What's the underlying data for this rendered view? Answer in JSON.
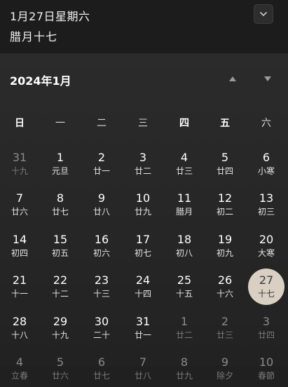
{
  "header": {
    "date": "1月27日星期六",
    "lunar_date": "腊月十七"
  },
  "calendar": {
    "month_title": "2024年1月",
    "weekdays": [
      "日",
      "一",
      "二",
      "三",
      "四",
      "五",
      "六"
    ],
    "weeks": [
      [
        {
          "day": "31",
          "lunar": "十九",
          "dim": true
        },
        {
          "day": "1",
          "lunar": "元旦"
        },
        {
          "day": "2",
          "lunar": "廿一"
        },
        {
          "day": "3",
          "lunar": "廿二"
        },
        {
          "day": "4",
          "lunar": "廿三"
        },
        {
          "day": "5",
          "lunar": "廿四"
        },
        {
          "day": "6",
          "lunar": "小寒"
        }
      ],
      [
        {
          "day": "7",
          "lunar": "廿六"
        },
        {
          "day": "8",
          "lunar": "廿七"
        },
        {
          "day": "9",
          "lunar": "廿八"
        },
        {
          "day": "10",
          "lunar": "廿九"
        },
        {
          "day": "11",
          "lunar": "腊月"
        },
        {
          "day": "12",
          "lunar": "初二"
        },
        {
          "day": "13",
          "lunar": "初三"
        }
      ],
      [
        {
          "day": "14",
          "lunar": "初四"
        },
        {
          "day": "15",
          "lunar": "初五"
        },
        {
          "day": "16",
          "lunar": "初六"
        },
        {
          "day": "17",
          "lunar": "初七"
        },
        {
          "day": "18",
          "lunar": "初八"
        },
        {
          "day": "19",
          "lunar": "初九"
        },
        {
          "day": "20",
          "lunar": "大寒"
        }
      ],
      [
        {
          "day": "21",
          "lunar": "十一"
        },
        {
          "day": "22",
          "lunar": "十二"
        },
        {
          "day": "23",
          "lunar": "十三"
        },
        {
          "day": "24",
          "lunar": "十四"
        },
        {
          "day": "25",
          "lunar": "十五"
        },
        {
          "day": "26",
          "lunar": "十六"
        },
        {
          "day": "27",
          "lunar": "十七",
          "selected": true
        }
      ],
      [
        {
          "day": "28",
          "lunar": "十八"
        },
        {
          "day": "29",
          "lunar": "十九"
        },
        {
          "day": "30",
          "lunar": "二十"
        },
        {
          "day": "31",
          "lunar": "廿一"
        },
        {
          "day": "1",
          "lunar": "廿二",
          "dim": true
        },
        {
          "day": "2",
          "lunar": "廿三",
          "dim": true
        },
        {
          "day": "3",
          "lunar": "廿四",
          "dim": true
        }
      ],
      [
        {
          "day": "4",
          "lunar": "立春",
          "dim": true
        },
        {
          "day": "5",
          "lunar": "廿六",
          "dim": true
        },
        {
          "day": "6",
          "lunar": "廿七",
          "dim": true
        },
        {
          "day": "7",
          "lunar": "廿八",
          "dim": true
        },
        {
          "day": "8",
          "lunar": "廿九",
          "dim": true
        },
        {
          "day": "9",
          "lunar": "除夕",
          "dim": true
        },
        {
          "day": "10",
          "lunar": "春節",
          "dim": true
        }
      ]
    ]
  },
  "icons": {
    "collapse": "chevron-down-icon",
    "previous_month": "triangle-up-icon",
    "next_month": "triangle-down-icon"
  },
  "colors": {
    "selected_day_bg": "#d9cfc2",
    "background": "#202020"
  }
}
